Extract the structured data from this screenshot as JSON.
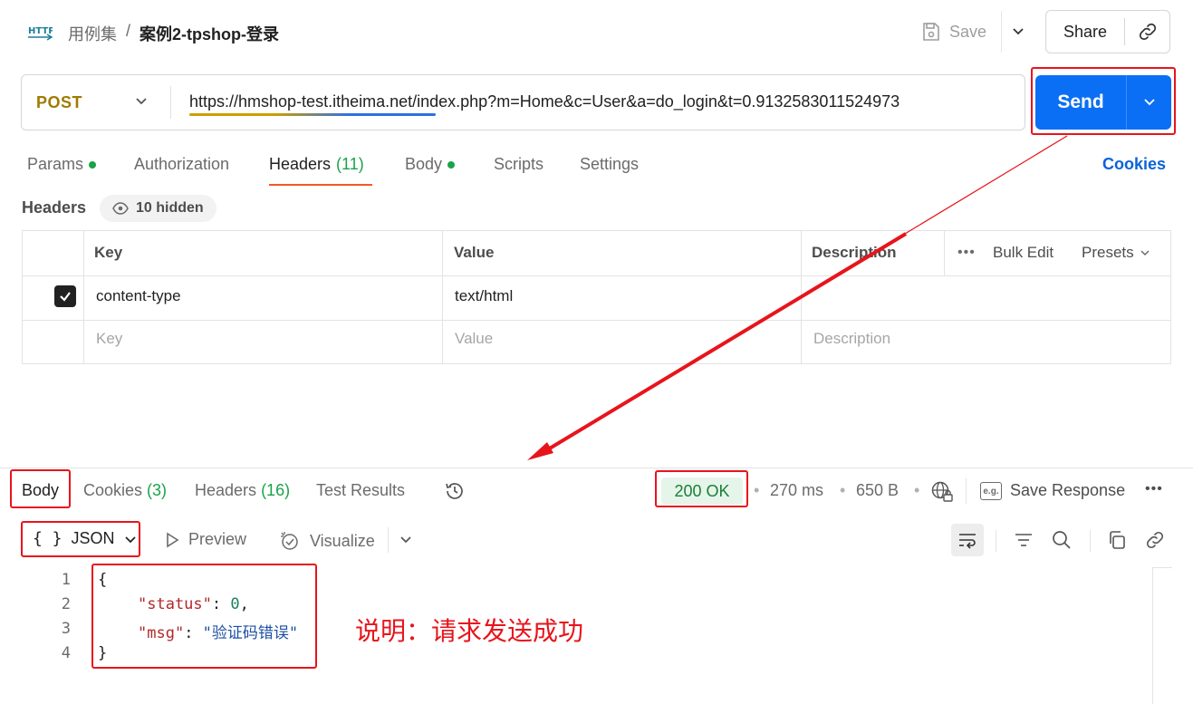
{
  "topbar": {
    "icon": "http-icon",
    "breadcrumb_parent": "用例集",
    "breadcrumb_sep": "/",
    "breadcrumb_current": "案例2-tpshop-登录",
    "save_label": "Save",
    "share_label": "Share"
  },
  "request": {
    "method": "POST",
    "url": "https://hmshop-test.itheima.net/index.php?m=Home&c=User&a=do_login&t=0.9132583011524973",
    "send_label": "Send",
    "tabs": [
      {
        "label": "Params",
        "dot": true
      },
      {
        "label": "Authorization"
      },
      {
        "label": "Headers",
        "count": "(11)",
        "active": true
      },
      {
        "label": "Body",
        "dot": true
      },
      {
        "label": "Scripts"
      },
      {
        "label": "Settings"
      }
    ],
    "cookies_label": "Cookies"
  },
  "headers": {
    "title": "Headers",
    "hidden_label": "10 hidden",
    "columns": {
      "key": "Key",
      "value": "Value",
      "description": "Description"
    },
    "more": "•••",
    "bulk_edit": "Bulk Edit",
    "presets": "Presets",
    "rows": [
      {
        "checked": true,
        "key": "content-type",
        "value": "text/html",
        "description": ""
      }
    ],
    "placeholders": {
      "key": "Key",
      "value": "Value",
      "description": "Description"
    }
  },
  "response": {
    "tabs": {
      "body": "Body",
      "cookies": "Cookies",
      "cookies_count": "(3)",
      "headers": "Headers",
      "headers_count": "(16)",
      "tests": "Test Results"
    },
    "status": "200 OK",
    "time": "270 ms",
    "size": "650 B",
    "dot": "•",
    "save_response": "Save Response",
    "more": "•••",
    "format": "JSON",
    "format_braces": "{ }",
    "preview": "Preview",
    "visualize": "Visualize",
    "code_lines": {
      "l1": "{",
      "l2_key": "\"status\"",
      "l2_colon": ": ",
      "l2_val": "0",
      "l2_comma": ",",
      "l3_key": "\"msg\"",
      "l3_colon": ": ",
      "l3_val": "\"验证码错误\"",
      "l4": "}"
    },
    "line_numbers": [
      "1",
      "2",
      "3",
      "4"
    ]
  },
  "annotation": {
    "note": "说明：请求发送成功",
    "color": "#e8141c"
  },
  "colors": {
    "send": "#0b6ff5",
    "method": "#a07b00",
    "status_green": "#1a7f37",
    "tab_underline": "#ef5b25",
    "link_blue": "#0b63d6"
  }
}
